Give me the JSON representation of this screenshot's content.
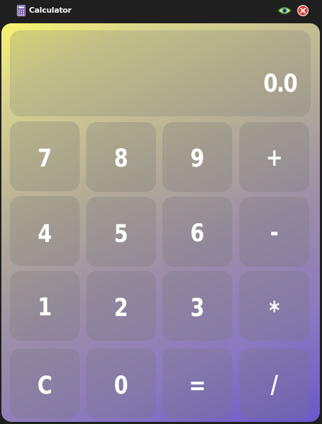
{
  "window": {
    "title": "Calculator",
    "icon": "calculator-icon",
    "controls": [
      "eye-icon",
      "close-icon"
    ]
  },
  "colors": {
    "titlebar": "#1f1f1f",
    "gradient_start": "#f7f46f",
    "gradient_end": "#6a58cc",
    "close_red": "#e03a2f"
  },
  "display": {
    "value": "0.0"
  },
  "keys": [
    {
      "label": "7",
      "name": "key-7"
    },
    {
      "label": "8",
      "name": "key-8"
    },
    {
      "label": "9",
      "name": "key-9"
    },
    {
      "label": "+",
      "name": "key-add"
    },
    {
      "label": "4",
      "name": "key-4"
    },
    {
      "label": "5",
      "name": "key-5"
    },
    {
      "label": "6",
      "name": "key-6"
    },
    {
      "label": "-",
      "name": "key-subtract"
    },
    {
      "label": "1",
      "name": "key-1"
    },
    {
      "label": "2",
      "name": "key-2"
    },
    {
      "label": "3",
      "name": "key-3"
    },
    {
      "label": "*",
      "name": "key-multiply"
    },
    {
      "label": "C",
      "name": "key-clear"
    },
    {
      "label": "0",
      "name": "key-0"
    },
    {
      "label": "=",
      "name": "key-equals"
    },
    {
      "label": "/",
      "name": "key-divide"
    }
  ]
}
